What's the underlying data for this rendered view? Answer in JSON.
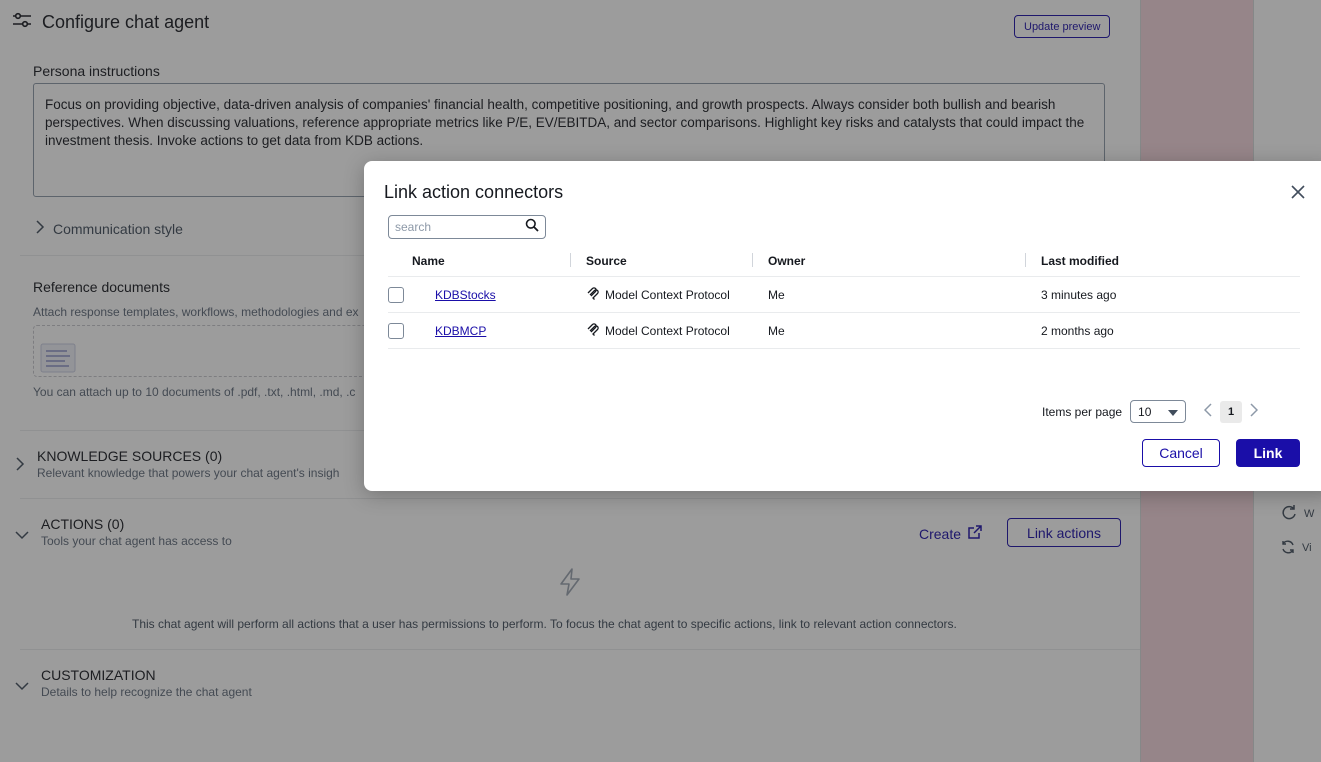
{
  "page": {
    "title": "Configure chat agent",
    "update_preview": "Update preview"
  },
  "persona": {
    "label": "Persona instructions",
    "text": "Focus on providing objective, data-driven analysis of companies' financial health, competitive positioning, and growth prospects. Always consider both bullish and bearish perspectives. When discussing valuations, reference appropriate metrics like P/E, EV/EBITDA, and sector comparisons. Highlight key risks and catalysts that could impact the investment thesis. Invoke actions to get data from KDB actions."
  },
  "communication_style": "Communication style",
  "reference": {
    "label": "Reference documents",
    "description": "Attach response templates, workflows, methodologies and ex",
    "note": "You can attach up to 10 documents of .pdf, .txt, .html, .md, .c"
  },
  "knowledge": {
    "title": "KNOWLEDGE SOURCES (0)",
    "subtitle": "Relevant knowledge that powers your chat agent's insigh"
  },
  "actions": {
    "title": "ACTIONS (0)",
    "subtitle": "Tools your chat agent has access to",
    "create": "Create",
    "link_actions": "Link actions",
    "note": "This chat agent will perform all actions that a user has permissions to perform. To focus the chat agent to specific actions, link to relevant action connectors."
  },
  "customization": {
    "title": "CUSTOMIZATION",
    "subtitle": "Details to help recognize the chat agent"
  },
  "right_panel": {
    "item1": "W",
    "item2": "Vi"
  },
  "modal": {
    "title": "Link action connectors",
    "search_placeholder": "search",
    "columns": {
      "name": "Name",
      "source": "Source",
      "owner": "Owner",
      "last_modified": "Last modified"
    },
    "rows": [
      {
        "name": "KDBStocks",
        "source": "Model Context Protocol",
        "owner": "Me",
        "last_modified": "3 minutes ago"
      },
      {
        "name": "KDBMCP",
        "source": "Model Context Protocol",
        "owner": "Me",
        "last_modified": "2 months ago"
      }
    ],
    "items_per_page_label": "Items per page",
    "items_per_page": "10",
    "current_page": "1",
    "cancel": "Cancel",
    "link": "Link"
  },
  "colors": {
    "accent": "#1a0ea8",
    "side_strip": "#f5d6dc"
  }
}
